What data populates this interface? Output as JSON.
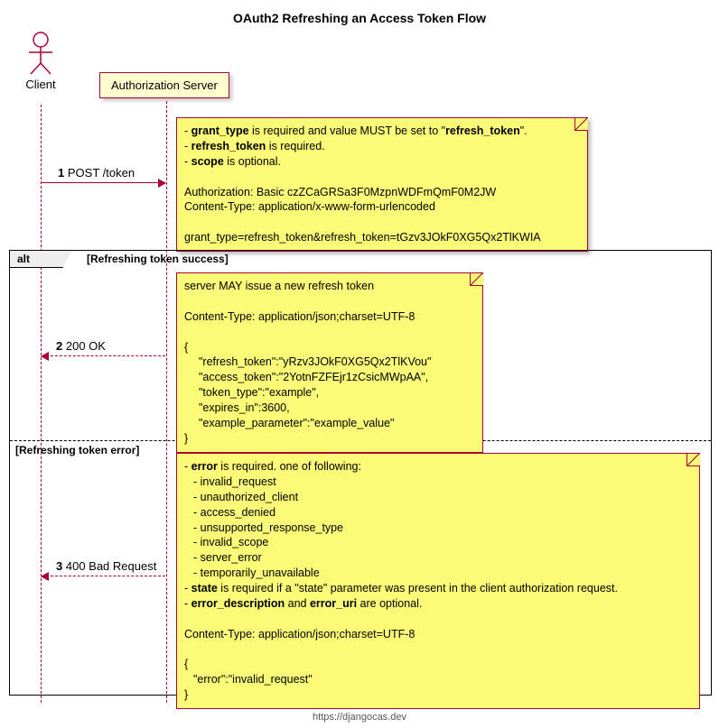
{
  "title": "OAuth2 Refreshing an Access Token Flow",
  "client_label": "Client",
  "server_label": "Authorization Server",
  "msg1": {
    "num": "1",
    "text": "POST /token"
  },
  "msg2": {
    "num": "2",
    "text": "200 OK"
  },
  "msg3": {
    "num": "3",
    "text": "400 Bad Request"
  },
  "alt_label": "alt",
  "alt_cond1": "[Refreshing token success]",
  "alt_cond2": "[Refreshing token error]",
  "note1": {
    "l1_prefix": "- ",
    "l1_b1": "grant_type",
    "l1_mid": " is required and value MUST be set to \"",
    "l1_b2": "refresh_token",
    "l1_suffix": "\".",
    "l2_prefix": "- ",
    "l2_b": "refresh_token",
    "l2_suffix": " is required.",
    "l3_prefix": "- ",
    "l3_b": "scope",
    "l3_suffix": " is optional.",
    "l5": "Authorization: Basic czZCaGRSa3F0MzpnWDFmQmF0M2JW",
    "l6": "Content-Type: application/x-www-form-urlencoded",
    "l8": "grant_type=refresh_token&refresh_token=tGzv3JOkF0XG5Qx2TlKWIA"
  },
  "note2": {
    "l1": "server MAY issue a new refresh token",
    "l3": "Content-Type: application/json;charset=UTF-8",
    "l5": "{",
    "l6": "\"refresh_token\":\"yRzv3JOkF0XG5Qx2TlKVou\"",
    "l7": "\"access_token\":\"2YotnFZFEjr1zCsicMWpAA\",",
    "l8": "\"token_type\":\"example\",",
    "l9": "\"expires_in\":3600,",
    "l10": "\"example_parameter\":\"example_value\"",
    "l11": "}"
  },
  "note3": {
    "l1_prefix": "- ",
    "l1_b": "error",
    "l1_suffix": " is required. one of following:",
    "e1": "- invalid_request",
    "e2": "- unauthorized_client",
    "e3": "- access_denied",
    "e4": "- unsupported_response_type",
    "e5": "- invalid_scope",
    "e6": "- server_error",
    "e7": "- temporarily_unavailable",
    "l2_prefix": "- ",
    "l2_b": "state",
    "l2_suffix": " is required if a \"state\" parameter was present in the client authorization request.",
    "l3_prefix": "- ",
    "l3_b1": "error_description",
    "l3_mid": " and ",
    "l3_b2": "error_uri",
    "l3_suffix": " are optional.",
    "l5": "Content-Type: application/json;charset=UTF-8",
    "l7": "{",
    "l8": "\"error\":\"invalid_request\"",
    "l9": "}"
  },
  "footer": "https://djangocas.dev"
}
